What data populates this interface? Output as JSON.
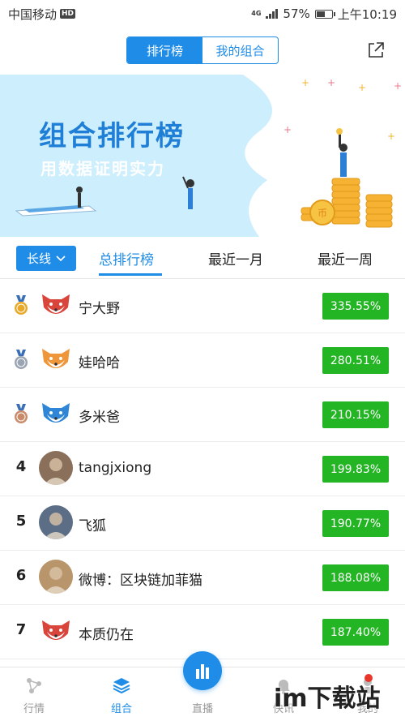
{
  "status_bar": {
    "carrier": "中国移动",
    "hd_badge": "HD",
    "network": "4G",
    "battery_percent": "57%",
    "battery_level": 0.57,
    "time": "上午10:19"
  },
  "header": {
    "tabs": [
      {
        "label": "排行榜",
        "active": true
      },
      {
        "label": "我的组合",
        "active": false
      }
    ],
    "share_icon": "share-icon"
  },
  "banner": {
    "title": "组合排行榜",
    "subtitle": "用数据证明实力"
  },
  "filters": {
    "dropdown": "长线",
    "tabs": [
      {
        "label": "总排行榜",
        "active": true
      },
      {
        "label": "最近一月",
        "active": false
      },
      {
        "label": "最近一周",
        "active": false
      }
    ]
  },
  "ranking": [
    {
      "rank": "1",
      "medal": "gold",
      "avatar": "fox-red",
      "name": "宁大野",
      "return": "335.55%"
    },
    {
      "rank": "2",
      "medal": "silver",
      "avatar": "fox-orange",
      "name": "娃哈哈",
      "return": "280.51%"
    },
    {
      "rank": "3",
      "medal": "bronze",
      "avatar": "fox-blue",
      "name": "多米爸",
      "return": "210.15%"
    },
    {
      "rank": "4",
      "medal": "",
      "avatar": "photo",
      "name": "tangjxiong",
      "return": "199.83%"
    },
    {
      "rank": "5",
      "medal": "",
      "avatar": "photo",
      "name": "飞狐",
      "return": "190.77%"
    },
    {
      "rank": "6",
      "medal": "",
      "avatar": "photo",
      "name": "微博：区块链加菲猫",
      "return": "188.08%"
    },
    {
      "rank": "7",
      "medal": "",
      "avatar": "fox-red",
      "name": "本质仍在",
      "return": "187.40%"
    }
  ],
  "bottom_nav": [
    {
      "label": "行情",
      "icon": "market-icon",
      "active": false
    },
    {
      "label": "组合",
      "icon": "layers-icon",
      "active": true
    },
    {
      "label": "直播",
      "icon": "bar-chart-icon",
      "active": false
    },
    {
      "label": "快讯",
      "icon": "bell-icon",
      "active": false
    },
    {
      "label": "我的",
      "icon": "user-icon",
      "active": false
    }
  ],
  "watermark": "im下载站",
  "colors": {
    "accent": "#1f8de8",
    "positive": "#23b523",
    "banner_bg": "#cdeefc"
  }
}
